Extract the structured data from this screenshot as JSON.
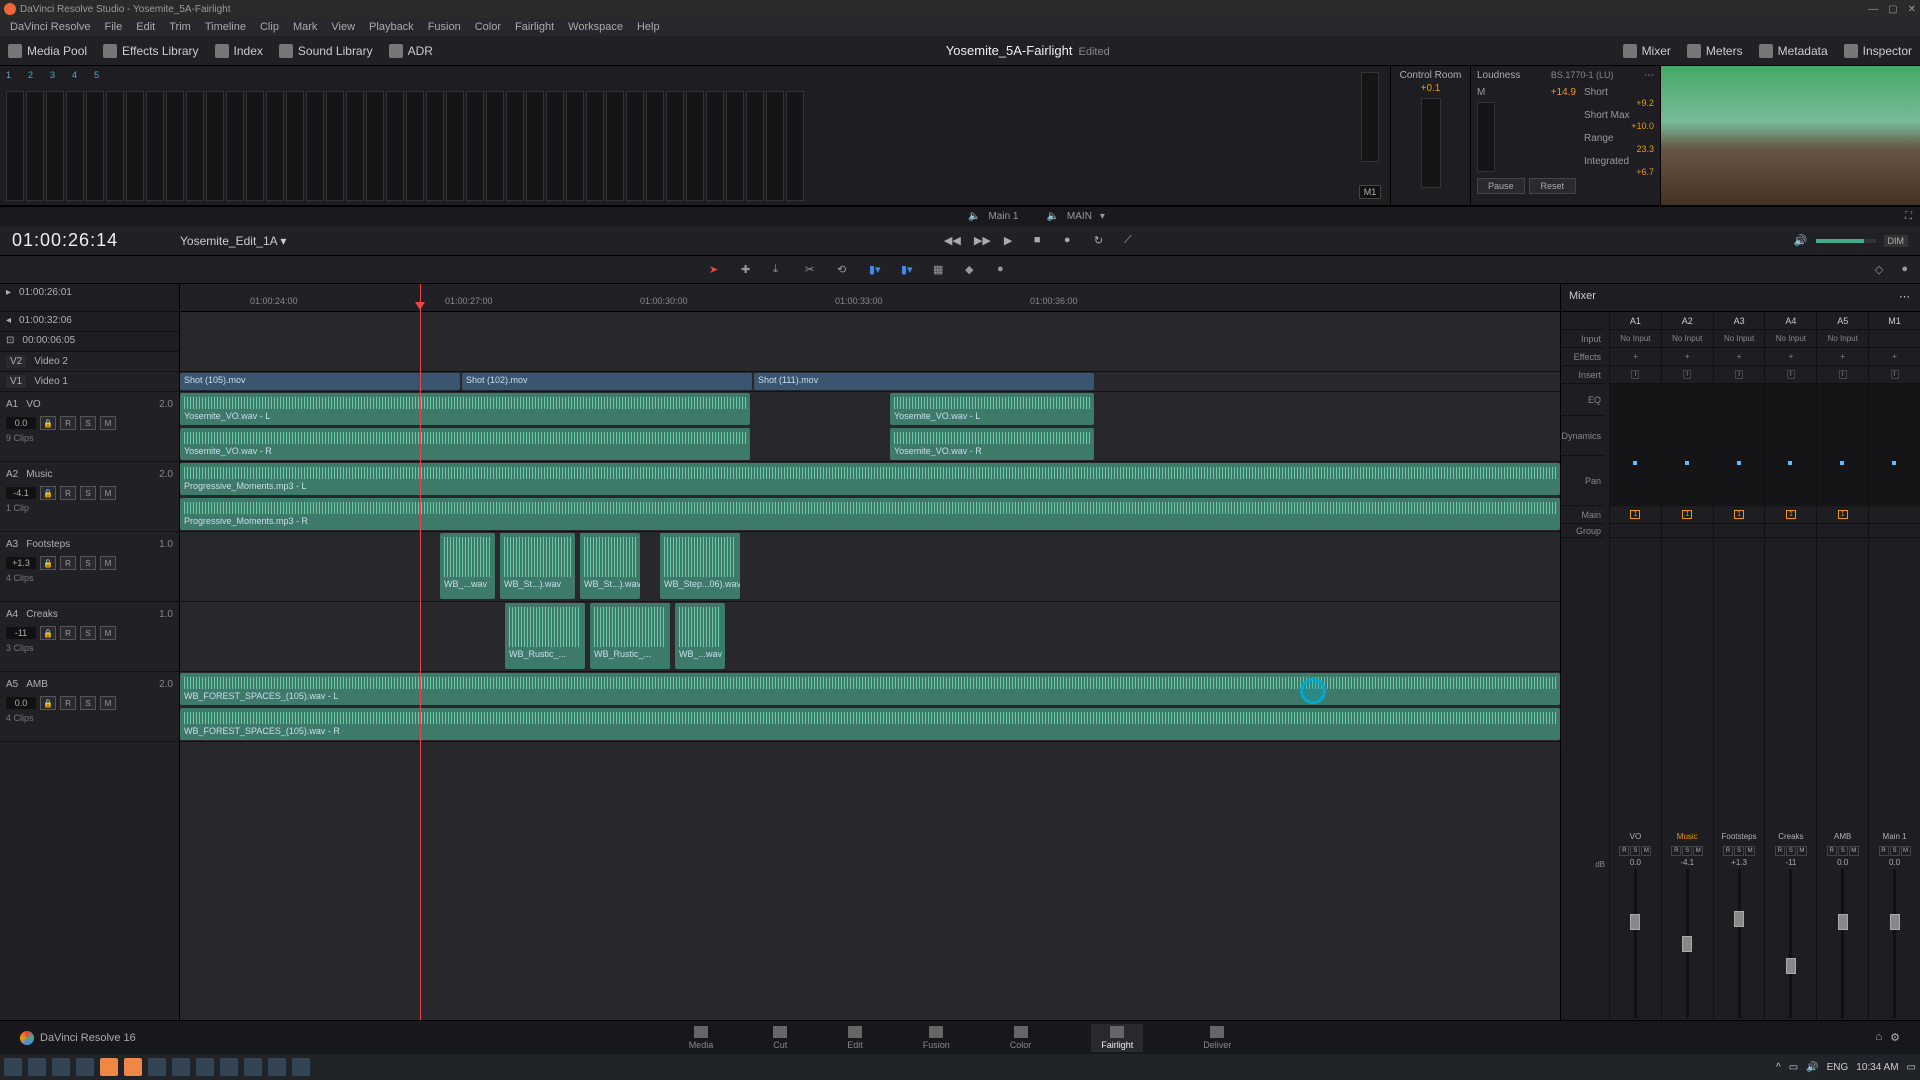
{
  "window": {
    "title": "DaVinci Resolve Studio - Yosemite_5A-Fairlight"
  },
  "menu": [
    "DaVinci Resolve",
    "File",
    "Edit",
    "Trim",
    "Timeline",
    "Clip",
    "Mark",
    "View",
    "Playback",
    "Fusion",
    "Color",
    "Fairlight",
    "Workspace",
    "Help"
  ],
  "toolbar": {
    "media_pool": "Media Pool",
    "effects": "Effects Library",
    "index": "Index",
    "sound": "Sound Library",
    "adr": "ADR",
    "project": "Yosemite_5A-Fairlight",
    "edited": "Edited",
    "mixer": "Mixer",
    "meters": "Meters",
    "metadata": "Metadata",
    "inspector": "Inspector"
  },
  "bus": {
    "label": "M1"
  },
  "control_room": {
    "title": "Control Room",
    "value": "+0.1"
  },
  "loudness": {
    "title": "Loudness",
    "standard": "BS.1770-1 (LU)",
    "m_label": "M",
    "m_value": "+14.9",
    "short_label": "Short",
    "short_value": "+9.2",
    "shortmax_label": "Short Max",
    "shortmax_value": "+10.0",
    "range_label": "Range",
    "range_value": "23.3",
    "integrated_label": "Integrated",
    "integrated_value": "+6.7",
    "pause": "Pause",
    "reset": "Reset"
  },
  "monitors": {
    "left": "Main 1",
    "right": "MAIN"
  },
  "timecode": "01:00:26:14",
  "timeline_name": "Yosemite_Edit_1A",
  "sub_tc": {
    "a": "01:00:26:01",
    "b": "01:00:32:06",
    "c": "00:00:06:05"
  },
  "dim": "DIM",
  "ruler": [
    "01:00:24:00",
    "01:00:27:00",
    "01:00:30:00",
    "01:00:33:00",
    "01:00:36:00"
  ],
  "tracks": {
    "video": [
      {
        "tag": "V2",
        "name": "Video 2"
      },
      {
        "tag": "V1",
        "name": "Video 1"
      }
    ],
    "audio": [
      {
        "tag": "A1",
        "name": "VO",
        "ch": "2.0",
        "lvl": "0.0",
        "clips": "9 Clips"
      },
      {
        "tag": "A2",
        "name": "Music",
        "ch": "2.0",
        "lvl": "-4.1",
        "clips": "1 Clip"
      },
      {
        "tag": "A3",
        "name": "Footsteps",
        "ch": "1.0",
        "lvl": "+1.3",
        "clips": "4 Clips"
      },
      {
        "tag": "A4",
        "name": "Creaks",
        "ch": "1.0",
        "lvl": "-11",
        "clips": "3 Clips"
      },
      {
        "tag": "A5",
        "name": "AMB",
        "ch": "2.0",
        "lvl": "0.0",
        "clips": "4 Clips"
      }
    ]
  },
  "clips": {
    "v1": [
      {
        "name": "Shot (105).mov"
      },
      {
        "name": "Shot (102).mov"
      },
      {
        "name": "Shot (111).mov"
      }
    ],
    "a1_l": "Yosemite_VO.wav - L",
    "a1_r": "Yosemite_VO.wav - R",
    "a2_l": "Progressive_Moments.mp3 - L",
    "a2_r": "Progressive_Moments.mp3 - R",
    "a3": [
      "WB_...wav",
      "WB_St...).wav",
      "WB_St...).wav",
      "WB_Step...06).wav"
    ],
    "a4": [
      "WB_Rustic_...",
      "WB_Rustic_...",
      "WB_...wav"
    ],
    "a5_l": "WB_FOREST_SPACES_(105).wav - L",
    "a5_r": "WB_FOREST_SPACES_(105).wav - R"
  },
  "track_buttons": {
    "r": "R",
    "s": "S",
    "m": "M"
  },
  "mixer": {
    "title": "Mixer",
    "rows": [
      "Input",
      "Effects",
      "Insert",
      "EQ",
      "Dynamics",
      "Pan",
      "Main",
      "Group"
    ],
    "channels": [
      "A1",
      "A2",
      "A3",
      "A4",
      "A5",
      "M1"
    ],
    "no_input": "No Input",
    "plus": "+",
    "insert": "I",
    "main1": "1",
    "faders": [
      {
        "name": "VO",
        "db": "0.0",
        "pos": 30
      },
      {
        "name": "Music",
        "db": "-4.1",
        "pos": 45,
        "music": true
      },
      {
        "name": "Footsteps",
        "db": "+1.3",
        "pos": 28
      },
      {
        "name": "Creaks",
        "db": "-11",
        "pos": 60
      },
      {
        "name": "AMB",
        "db": "0.0",
        "pos": 30
      },
      {
        "name": "Main 1",
        "db": "0.0",
        "pos": 30
      }
    ],
    "db_label": "dB"
  },
  "pages": [
    "Media",
    "Cut",
    "Edit",
    "Fusion",
    "Color",
    "Fairlight",
    "Deliver"
  ],
  "brand": "DaVinci Resolve 16",
  "tray": {
    "lang": "ENG",
    "time": "10:34 AM"
  }
}
